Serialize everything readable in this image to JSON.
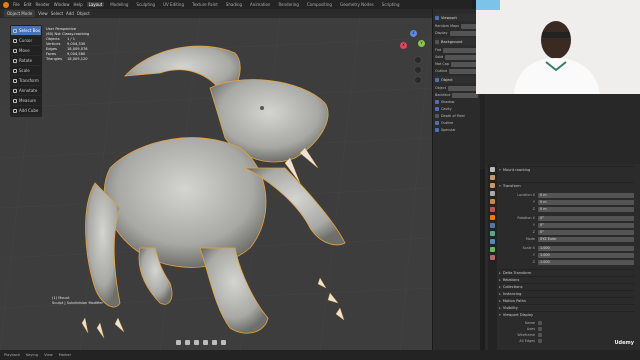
{
  "topbar": {
    "menus": [
      "File",
      "Edit",
      "Render",
      "Window",
      "Help"
    ],
    "workspaces": [
      "Layout",
      "Modeling",
      "Sculpting",
      "UV Editing",
      "Texture Paint",
      "Shading",
      "Animation",
      "Rendering",
      "Compositing",
      "Geometry Nodes",
      "Scripting"
    ],
    "active_workspace": "Layout"
  },
  "viewport_header": {
    "mode": "Object Mode",
    "items": [
      "View",
      "Select",
      "Add",
      "Object"
    ]
  },
  "tools": [
    "Select Box",
    "Cursor",
    "Move",
    "Rotate",
    "Scale",
    "Transform",
    "Annotate",
    "Measure",
    "Add Cube"
  ],
  "stats": {
    "title": "User Perspective",
    "subtitle": "(60) Not Classy.roarbing",
    "rows": [
      {
        "k": "Objects",
        "v": "1 / 1"
      },
      {
        "k": "Vertices",
        "v": "9,004,330"
      },
      {
        "k": "Edges",
        "v": "18,009,076"
      },
      {
        "k": "Faces",
        "v": "9,004,560"
      },
      {
        "k": "Triangles",
        "v": "18,009,120"
      }
    ]
  },
  "object_label": {
    "line1": "(1) Mount",
    "line2": "Sculpt | Subdivision Modifier"
  },
  "gizmo": {
    "x": "X",
    "y": "Y",
    "z": "Z"
  },
  "npanel": {
    "sections": [
      "Viewport",
      "Background",
      "Object"
    ],
    "rows": [
      "Random Maps",
      "Display",
      "Flat",
      "Solid",
      "Mat Cap",
      "Outline",
      "Object",
      "Backface",
      "Shadow",
      "Cavity",
      "Depth of Field",
      "Outline",
      "Specular"
    ]
  },
  "props": {
    "sections": [
      "Transform",
      "Delta Transform",
      "Relations",
      "Collections",
      "Instancing",
      "Motion Paths",
      "Visibility",
      "Viewport Display"
    ],
    "header": "Mount.roarbing",
    "rows": [
      {
        "lbl": "Location X",
        "val": "0 m"
      },
      {
        "lbl": "Y",
        "val": "0 m"
      },
      {
        "lbl": "Z",
        "val": "0 m"
      },
      {
        "lbl": "Rotation X",
        "val": "0°"
      },
      {
        "lbl": "Y",
        "val": "0°"
      },
      {
        "lbl": "Z",
        "val": "0°"
      },
      {
        "lbl": "Mode",
        "val": "XYZ Euler"
      },
      {
        "lbl": "Scale X",
        "val": "1.000"
      },
      {
        "lbl": "Y",
        "val": "1.000"
      },
      {
        "lbl": "Z",
        "val": "1.000"
      }
    ],
    "display_rows": [
      "Name",
      "Axes",
      "Wireframe",
      "All Edges",
      "Texture Space",
      "Shadow"
    ]
  },
  "statusbar": {
    "items": [
      "Playback",
      "Keying",
      "View",
      "Marker"
    ]
  },
  "watermark": "Udemy",
  "colors": {
    "accent": "#4772b3",
    "viewport_bg": "#3d3d3d",
    "selection_outline": "#e8a03a"
  }
}
